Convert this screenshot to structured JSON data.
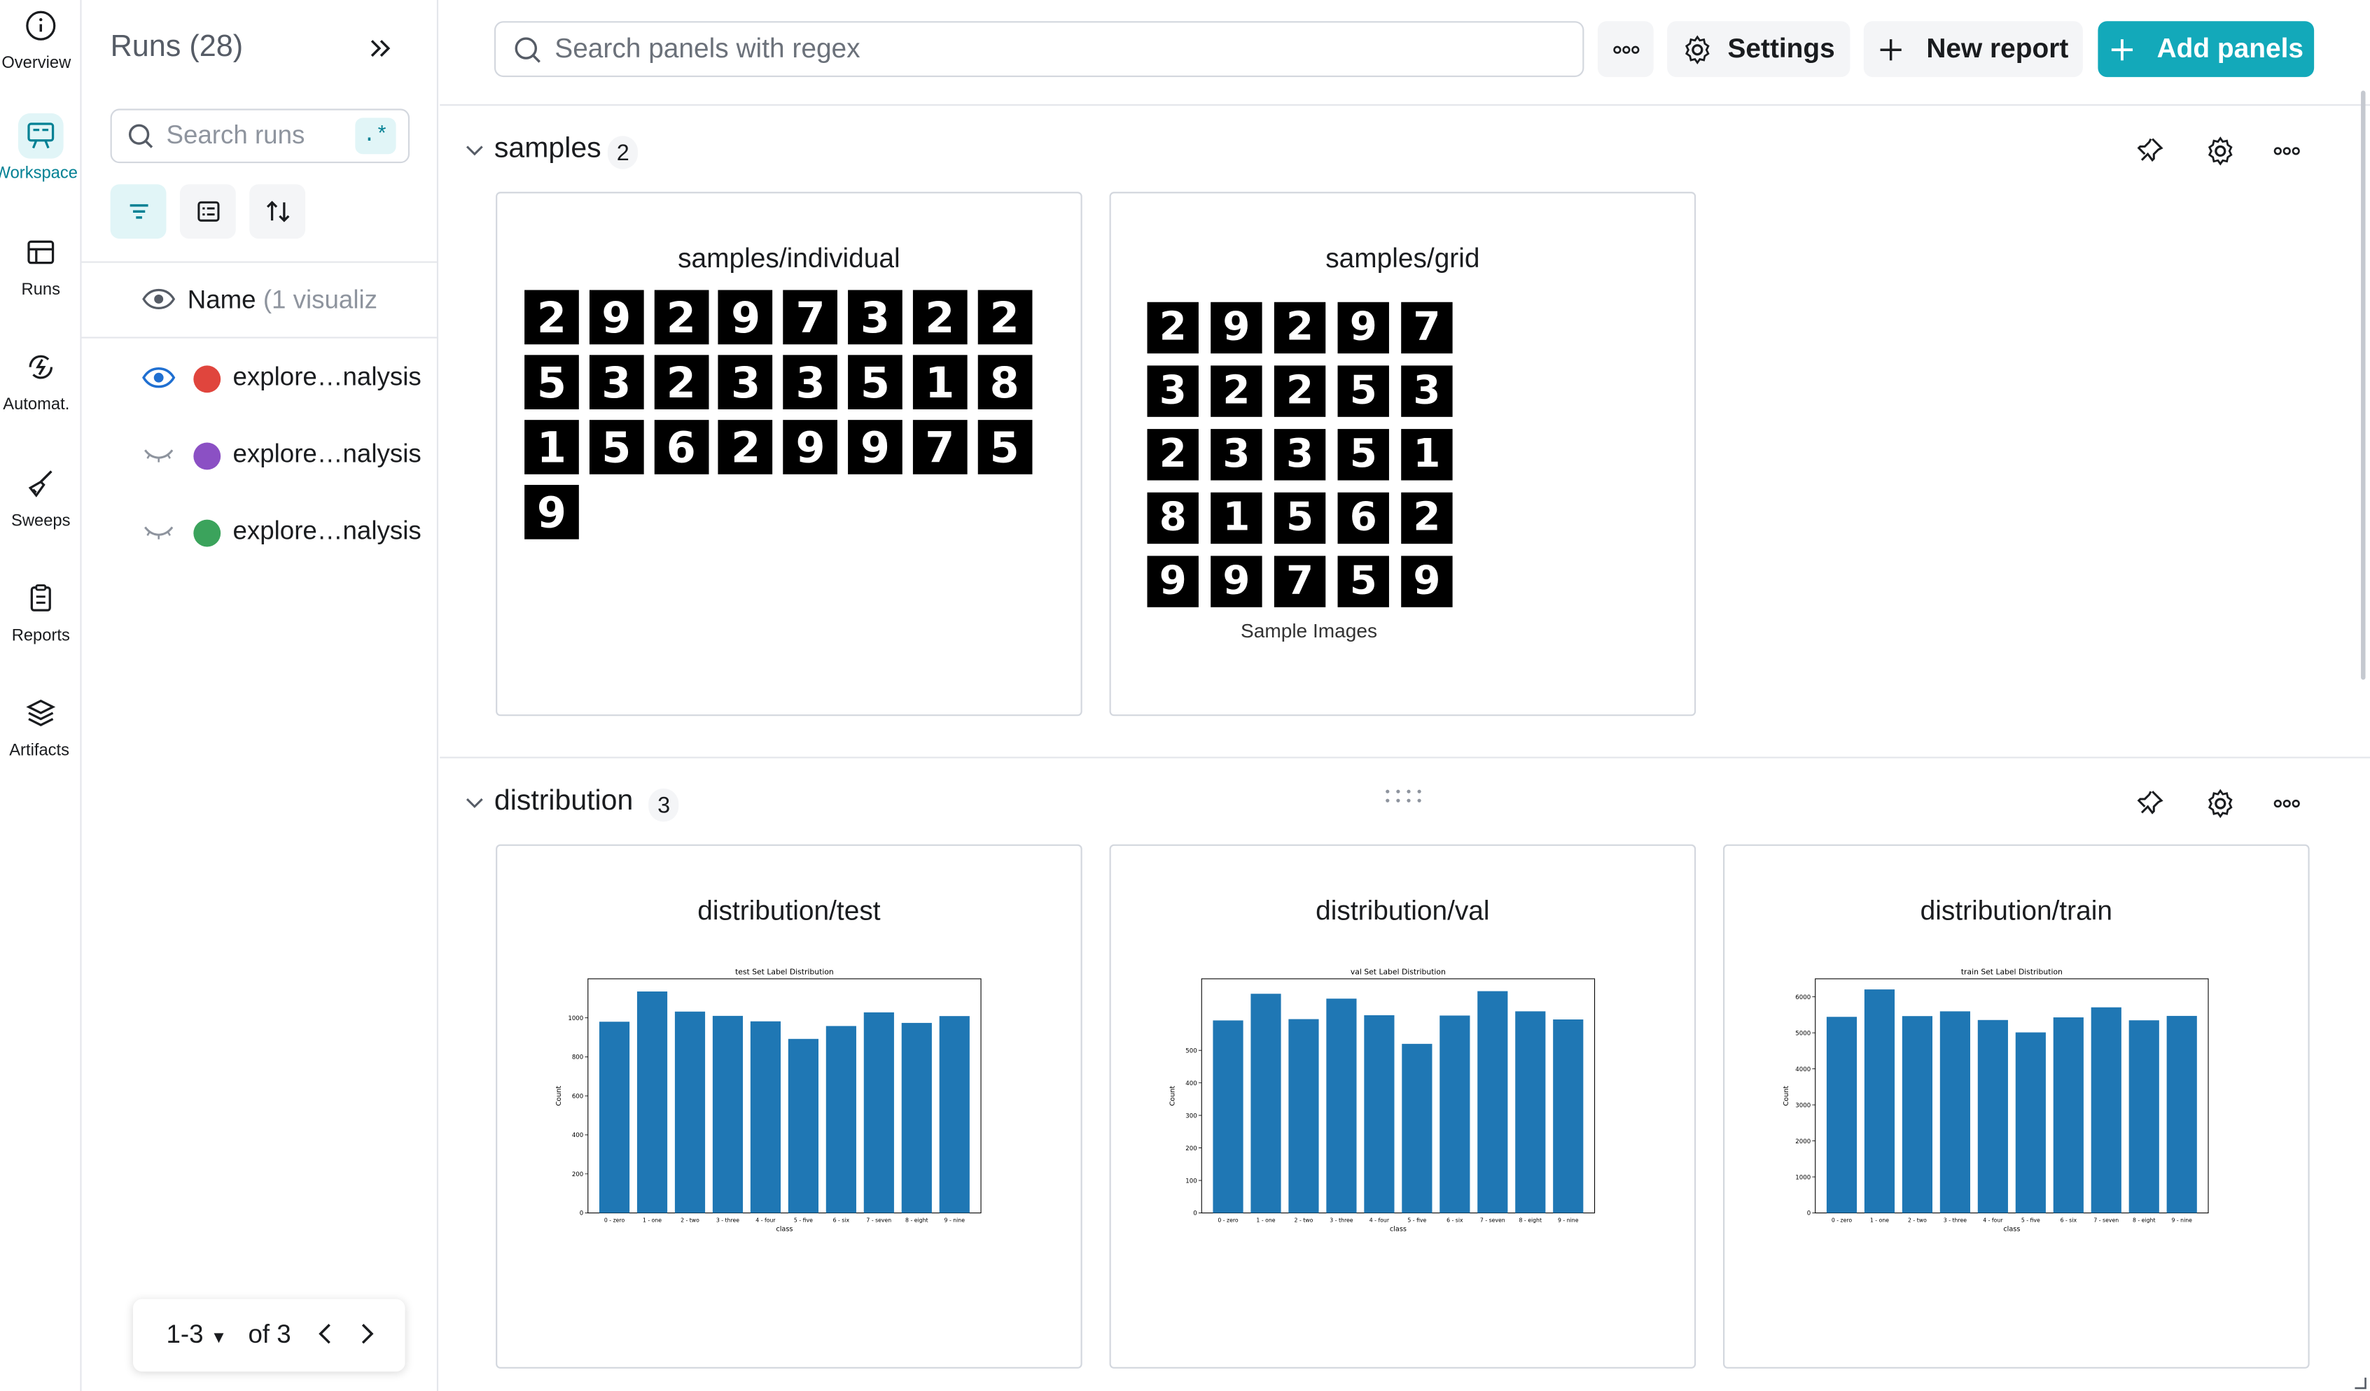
{
  "nav": [
    {
      "label": "Overview",
      "icon": "info-icon"
    },
    {
      "label": "Workspace",
      "icon": "workspace-icon",
      "active": true
    },
    {
      "label": "Runs",
      "icon": "table-icon"
    },
    {
      "label": "Automat.",
      "icon": "automation-icon"
    },
    {
      "label": "Sweeps",
      "icon": "broom-icon"
    },
    {
      "label": "Reports",
      "icon": "clipboard-icon"
    },
    {
      "label": "Artifacts",
      "icon": "layers-icon"
    }
  ],
  "runs": {
    "title": "Runs (28)",
    "search_placeholder": "Search runs",
    "regex_label": ".*",
    "header_name": "Name",
    "header_sub": "(1 visualiz",
    "items": [
      {
        "name": "explore…nalysis",
        "color": "#e0453d",
        "visible": true
      },
      {
        "name": "explore…nalysis",
        "color": "#8b50c4",
        "visible": false
      },
      {
        "name": "explore…nalysis",
        "color": "#3ba35c",
        "visible": false
      }
    ],
    "pager": {
      "range": "1-3",
      "of": "of 3"
    }
  },
  "topbar": {
    "search_placeholder": "Search panels with regex",
    "settings_label": "Settings",
    "new_report_label": "New report",
    "add_panels_label": "Add panels"
  },
  "sections": {
    "samples": {
      "title": "samples",
      "count": "2",
      "panels": {
        "individual": {
          "title": "samples/individual",
          "digits": [
            "2",
            "9",
            "2",
            "9",
            "7",
            "3",
            "2",
            "2",
            "5",
            "3",
            "2",
            "3",
            "3",
            "5",
            "1",
            "8",
            "1",
            "5",
            "6",
            "2",
            "9",
            "9",
            "7",
            "5",
            "9"
          ]
        },
        "grid": {
          "title": "samples/grid",
          "caption": "Sample Images",
          "digits": [
            "2",
            "9",
            "2",
            "9",
            "7",
            "3",
            "2",
            "2",
            "5",
            "3",
            "2",
            "3",
            "3",
            "5",
            "1",
            "8",
            "1",
            "5",
            "6",
            "2",
            "9",
            "9",
            "7",
            "5",
            "9"
          ]
        }
      }
    },
    "distribution": {
      "title": "distribution",
      "count": "3",
      "panels": {
        "test": {
          "title": "distribution/test"
        },
        "val": {
          "title": "distribution/val"
        },
        "train": {
          "title": "distribution/train"
        }
      }
    }
  },
  "chart_data": [
    {
      "type": "bar",
      "title": "test Set Label Distribution",
      "xlabel": "class",
      "ylabel": "Count",
      "categories": [
        "0 - zero",
        "1 - one",
        "2 - two",
        "3 - three",
        "4 - four",
        "5 - five",
        "6 - six",
        "7 - seven",
        "8 - eight",
        "9 - nine"
      ],
      "values": [
        980,
        1135,
        1032,
        1010,
        982,
        892,
        958,
        1028,
        974,
        1009
      ],
      "ylim": [
        0,
        1200
      ],
      "yticks": [
        0,
        200,
        400,
        600,
        800,
        1000
      ],
      "color": "#1f77b4"
    },
    {
      "type": "bar",
      "title": "val Set Label Distribution",
      "xlabel": "class",
      "ylabel": "Count",
      "categories": [
        "0 - zero",
        "1 - one",
        "2 - two",
        "3 - three",
        "4 - four",
        "5 - five",
        "6 - six",
        "7 - seven",
        "8 - eight",
        "9 - nine"
      ],
      "values": [
        592,
        674,
        596,
        659,
        608,
        520,
        607,
        682,
        620,
        595
      ],
      "ylim": [
        0,
        720
      ],
      "yticks": [
        0,
        100,
        200,
        300,
        400,
        500
      ],
      "color": "#1f77b4"
    },
    {
      "type": "bar",
      "title": "train Set Label Distribution",
      "xlabel": "class",
      "ylabel": "Count",
      "categories": [
        "0 - zero",
        "1 - one",
        "2 - two",
        "3 - three",
        "4 - four",
        "5 - five",
        "6 - six",
        "7 - seven",
        "8 - eight",
        "9 - nine"
      ],
      "values": [
        5444,
        6205,
        5465,
        5597,
        5356,
        5012,
        5429,
        5708,
        5348,
        5470
      ],
      "ylim": [
        0,
        6500
      ],
      "yticks": [
        0,
        1000,
        2000,
        3000,
        4000,
        5000,
        6000
      ],
      "color": "#1f77b4"
    }
  ]
}
